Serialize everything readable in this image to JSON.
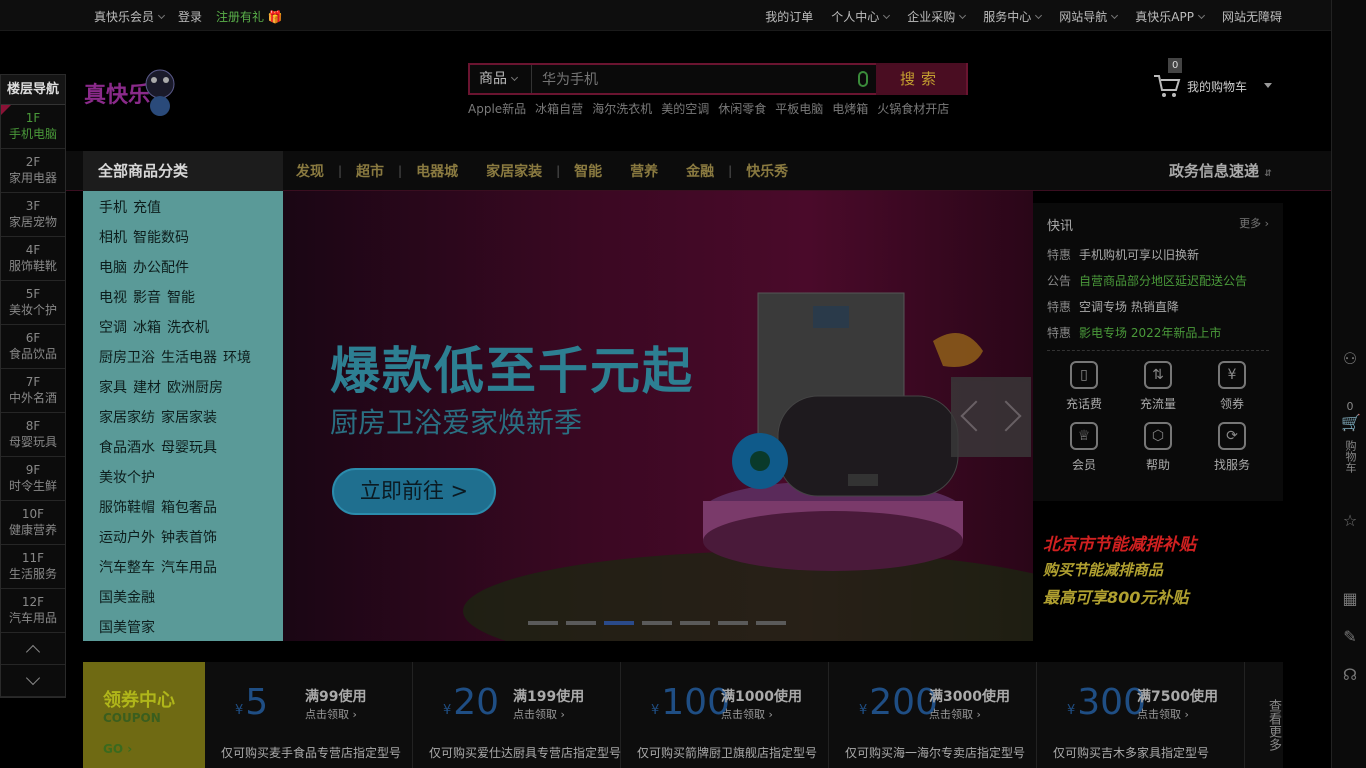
{
  "topbar": {
    "member": "真快乐会员",
    "login": "登录",
    "register": "注册有礼",
    "right": [
      {
        "label": "我的订单",
        "dropdown": false
      },
      {
        "label": "个人中心",
        "dropdown": true
      },
      {
        "label": "企业采购",
        "dropdown": true
      },
      {
        "label": "服务中心",
        "dropdown": true
      },
      {
        "label": "网站导航",
        "dropdown": true
      },
      {
        "label": "真快乐APP",
        "dropdown": true
      },
      {
        "label": "网站无障碍",
        "dropdown": false
      }
    ]
  },
  "search": {
    "category": "商品",
    "placeholder": "华为手机",
    "button": "搜索",
    "hotwords": [
      "Apple新品",
      "冰箱自营",
      "海尔洗衣机",
      "美的空调",
      "休闲零食",
      "平板电脑",
      "电烤箱",
      "火锅食材开店"
    ]
  },
  "cart": {
    "count": "0",
    "label": "我的购物车"
  },
  "nav": {
    "all_label": "全部商品分类",
    "links": [
      "发现",
      "超市",
      "电器城",
      "家居家装",
      "智能",
      "营养",
      "金融",
      "快乐秀"
    ],
    "gov": "政务信息速递"
  },
  "floor": {
    "header": "楼层导航",
    "items": [
      {
        "num": "1F",
        "name": "手机电脑"
      },
      {
        "num": "2F",
        "name": "家用电器"
      },
      {
        "num": "3F",
        "name": "家居宠物"
      },
      {
        "num": "4F",
        "name": "服饰鞋靴"
      },
      {
        "num": "5F",
        "name": "美妆个护"
      },
      {
        "num": "6F",
        "name": "食品饮品"
      },
      {
        "num": "7F",
        "name": "中外名酒"
      },
      {
        "num": "8F",
        "name": "母婴玩具"
      },
      {
        "num": "9F",
        "name": "时令生鲜"
      },
      {
        "num": "10F",
        "name": "健康营养"
      },
      {
        "num": "11F",
        "name": "生活服务"
      },
      {
        "num": "12F",
        "name": "汽车用品"
      }
    ]
  },
  "categories": [
    [
      "手机",
      "充值"
    ],
    [
      "相机",
      "智能数码"
    ],
    [
      "电脑",
      "办公配件"
    ],
    [
      "电视",
      "影音",
      "智能"
    ],
    [
      "空调",
      "冰箱",
      "洗衣机"
    ],
    [
      "厨房卫浴",
      "生活电器",
      "环境"
    ],
    [
      "家具",
      "建材",
      "欧洲厨房"
    ],
    [
      "家居家纺",
      "家居家装"
    ],
    [
      "食品酒水",
      "母婴玩具"
    ],
    [
      "美妆个护"
    ],
    [
      "服饰鞋帽",
      "箱包奢品"
    ],
    [
      "运动户外",
      "钟表首饰"
    ],
    [
      "汽车整车",
      "汽车用品"
    ],
    [
      "国美金融"
    ],
    [
      "国美管家"
    ]
  ],
  "banner": {
    "headline": "爆款低至千元起",
    "subline": "厨房卫浴爱家焕新季",
    "cta": "立即前往 >",
    "slides": 7,
    "active_slide": 3
  },
  "news": {
    "title": "快讯",
    "more": "更多",
    "items": [
      {
        "tag": "特惠",
        "text": "手机购机可享以旧换新",
        "green": false
      },
      {
        "tag": "公告",
        "text": "自营商品部分地区延迟配送公告",
        "green": true
      },
      {
        "tag": "特惠",
        "text": "空调专场 热销直降",
        "green": false
      },
      {
        "tag": "特惠",
        "text": "影电专场 2022年新品上市",
        "green": true
      }
    ],
    "quick": [
      {
        "label": "充话费",
        "icon": "phone-icon",
        "glyph": "▯"
      },
      {
        "label": "充流量",
        "icon": "data-flow-icon",
        "glyph": "⇅"
      },
      {
        "label": "领券",
        "icon": "coupon-icon",
        "glyph": "¥"
      },
      {
        "label": "会员",
        "icon": "crown-icon",
        "glyph": "♕"
      },
      {
        "label": "帮助",
        "icon": "help-icon",
        "glyph": "⬡"
      },
      {
        "label": "找服务",
        "icon": "service-icon",
        "glyph": "⟳"
      }
    ]
  },
  "subsidy": {
    "line1": "北京市节能减排补贴",
    "line2": "购买节能减排商品",
    "line3": "最高可享800元补贴"
  },
  "coupons": {
    "head_title": "领券中心",
    "head_sub": "COUPON",
    "head_go": "GO",
    "more": "查看更多",
    "items": [
      {
        "amount": "5",
        "cond": "满99使用",
        "claim": "点击领取",
        "desc": "仅可购买麦手食品专营店指定型号"
      },
      {
        "amount": "20",
        "cond": "满199使用",
        "claim": "点击领取",
        "desc": "仅可购买爱仕达厨具专营店指定型号"
      },
      {
        "amount": "100",
        "cond": "满1000使用",
        "claim": "点击领取",
        "desc": "仅可购买箭牌厨卫旗舰店指定型号"
      },
      {
        "amount": "200",
        "cond": "满3000使用",
        "claim": "点击领取",
        "desc": "仅可购买海一海尔专卖店指定型号"
      },
      {
        "amount": "300",
        "cond": "满7500使用",
        "claim": "点击领取",
        "desc": "仅可购买吉木多家具指定型号"
      }
    ]
  },
  "right_strip": {
    "cart_count": "0",
    "cart_label": "购物车"
  }
}
